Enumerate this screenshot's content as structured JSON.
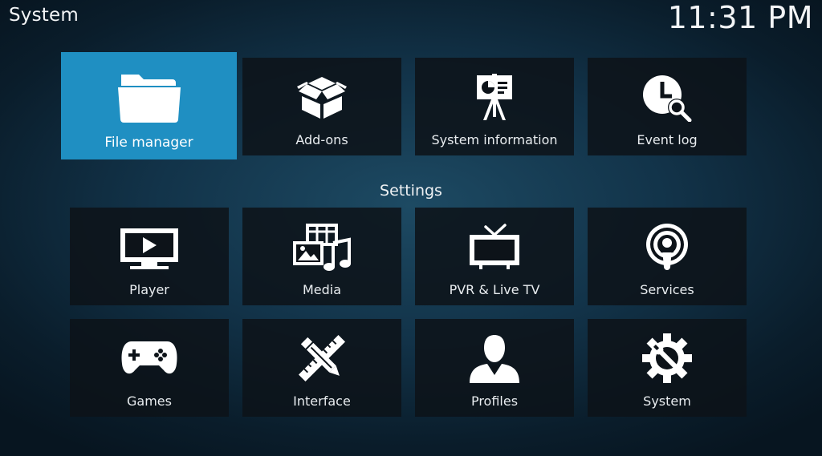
{
  "header": {
    "title": "System",
    "clock": "11:31 PM"
  },
  "top_row": [
    {
      "label": "File manager",
      "icon": "folder-icon",
      "focused": true
    },
    {
      "label": "Add-ons",
      "icon": "open-box-icon"
    },
    {
      "label": "System information",
      "icon": "presentation-easel-icon"
    },
    {
      "label": "Event log",
      "icon": "clock-search-icon"
    }
  ],
  "settings": {
    "title": "Settings",
    "items": [
      {
        "label": "Player",
        "icon": "play-monitor-icon"
      },
      {
        "label": "Media",
        "icon": "media-library-icon"
      },
      {
        "label": "PVR & Live TV",
        "icon": "tv-icon"
      },
      {
        "label": "Services",
        "icon": "broadcast-icon"
      },
      {
        "label": "Games",
        "icon": "gamepad-icon"
      },
      {
        "label": "Interface",
        "icon": "pencil-ruler-icon"
      },
      {
        "label": "Profiles",
        "icon": "user-profile-icon"
      },
      {
        "label": "System",
        "icon": "gear-wrench-icon"
      }
    ]
  },
  "colors": {
    "focus": "#1f8fc2",
    "tile": "#0d1319",
    "background": "#123349"
  }
}
